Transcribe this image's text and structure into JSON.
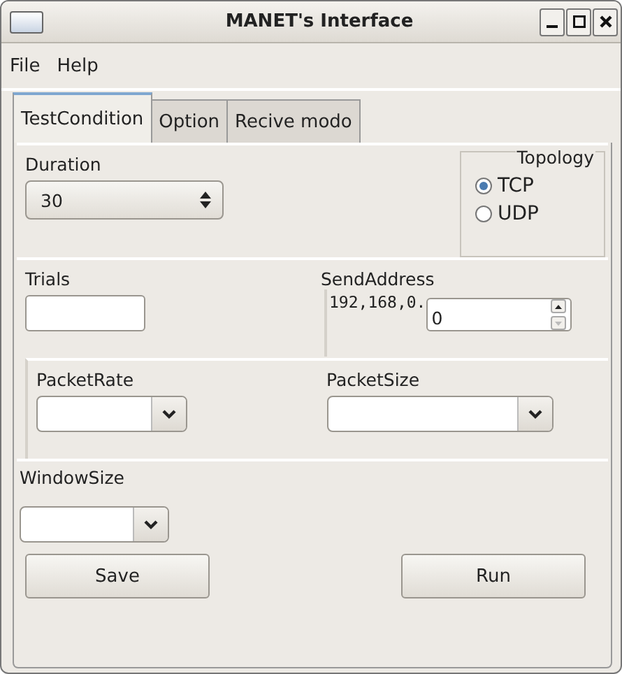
{
  "window": {
    "title": "MANET's Interface"
  },
  "menu": [
    "File",
    "Help"
  ],
  "tabs": [
    {
      "label": "TestCondition",
      "selected": true
    },
    {
      "label": "Option",
      "selected": false
    },
    {
      "label": "Recive modo",
      "selected": false
    }
  ],
  "duration": {
    "label": "Duration",
    "value": "30"
  },
  "topology": {
    "title": "Topology",
    "options": [
      {
        "label": "TCP",
        "selected": true
      },
      {
        "label": "UDP",
        "selected": false
      }
    ]
  },
  "trials": {
    "label": "Trials"
  },
  "send_address": {
    "label": "SendAddress",
    "prefix": "192,168,0.",
    "value": "0"
  },
  "packet_rate": {
    "label": "PacketRate"
  },
  "packet_size": {
    "label": "PacketSize"
  },
  "window_size": {
    "label": "WindowSize"
  },
  "buttons": [
    "Save",
    "Run"
  ]
}
